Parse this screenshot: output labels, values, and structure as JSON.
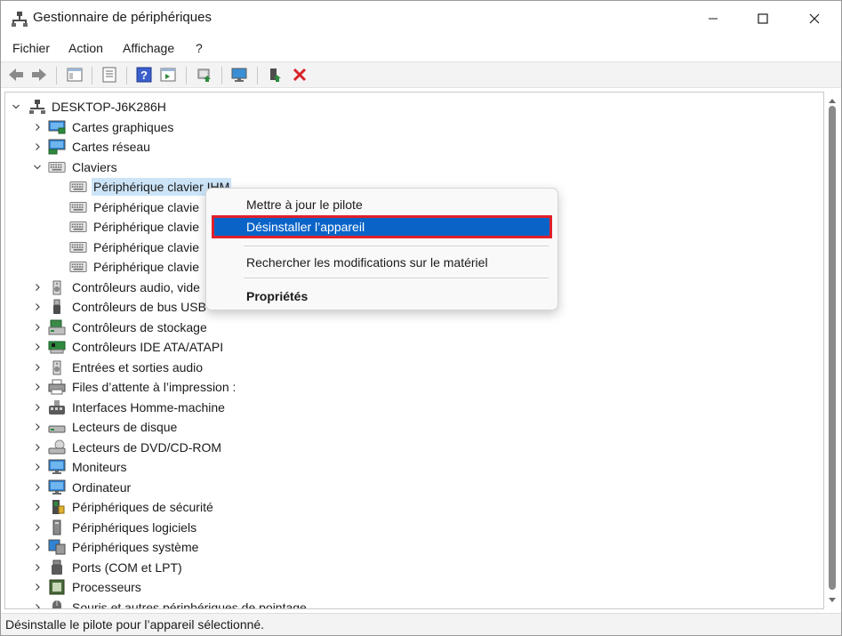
{
  "window": {
    "title": "Gestionnaire de périphériques"
  },
  "menu": {
    "items": [
      "Fichier",
      "Action",
      "Affichage",
      "?"
    ]
  },
  "tree": {
    "root": "DESKTOP-J6K286H",
    "rows": [
      {
        "label": "Cartes graphiques",
        "icon": "display-adapter-icon",
        "expanded": false
      },
      {
        "label": "Cartes réseau",
        "icon": "network-adapter-icon",
        "expanded": false
      },
      {
        "label": "Claviers",
        "icon": "keyboard-icon",
        "expanded": true
      },
      {
        "label": "Périphérique clavier IHM",
        "icon": "keyboard-icon",
        "child": true,
        "selected": true
      },
      {
        "label": "Périphérique clavie",
        "icon": "keyboard-icon",
        "child": true
      },
      {
        "label": "Périphérique clavie",
        "icon": "keyboard-icon",
        "child": true
      },
      {
        "label": "Périphérique clavie",
        "icon": "keyboard-icon",
        "child": true
      },
      {
        "label": "Périphérique clavie",
        "icon": "keyboard-icon",
        "child": true
      },
      {
        "label": "Contrôleurs audio, vide",
        "icon": "speaker-icon",
        "expanded": false
      },
      {
        "label": "Contrôleurs de bus USB",
        "icon": "usb-icon",
        "expanded": false
      },
      {
        "label": "Contrôleurs de stockage",
        "icon": "storage-controller-icon",
        "expanded": false
      },
      {
        "label": "Contrôleurs IDE ATA/ATAPI",
        "icon": "ide-controller-icon",
        "expanded": false
      },
      {
        "label": "Entrées et sorties audio",
        "icon": "speaker-icon",
        "expanded": false
      },
      {
        "label": "Files d’attente à l’impression :",
        "icon": "printer-icon",
        "expanded": false
      },
      {
        "label": "Interfaces Homme-machine",
        "icon": "hid-icon",
        "expanded": false
      },
      {
        "label": "Lecteurs de disque",
        "icon": "disk-drive-icon",
        "expanded": false
      },
      {
        "label": "Lecteurs de DVD/CD-ROM",
        "icon": "dvd-drive-icon",
        "expanded": false
      },
      {
        "label": "Moniteurs",
        "icon": "monitor-icon",
        "expanded": false
      },
      {
        "label": "Ordinateur",
        "icon": "computer-icon",
        "expanded": false
      },
      {
        "label": "Périphériques de sécurité",
        "icon": "security-device-icon",
        "expanded": false
      },
      {
        "label": "Périphériques logiciels",
        "icon": "software-device-icon",
        "expanded": false
      },
      {
        "label": "Périphériques système",
        "icon": "system-device-icon",
        "expanded": false
      },
      {
        "label": "Ports (COM et LPT)",
        "icon": "port-icon",
        "expanded": false
      },
      {
        "label": "Processeurs",
        "icon": "processor-icon",
        "expanded": false
      },
      {
        "label": "Souris et autres périphériques de pointage",
        "icon": "mouse-icon",
        "expanded": false
      }
    ]
  },
  "context_menu": {
    "update_driver": "Mettre à jour le pilote",
    "uninstall_device": "Désinstaller l’appareil",
    "scan_hardware": "Rechercher les modifications sur le matériel",
    "properties": "Propriétés"
  },
  "status": {
    "text": "Désinstalle le pilote pour l’appareil sélectionné."
  },
  "colors": {
    "highlight": "#0a64c8",
    "highlight_border": "#e0202a",
    "selection": "#cce4f7",
    "toolbar_bg": "#f3f3f3"
  }
}
